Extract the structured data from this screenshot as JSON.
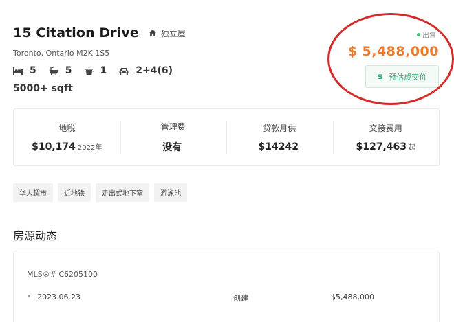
{
  "listing": {
    "address_title": "15 Citation Drive",
    "property_type": "独立屋",
    "location": "Toronto, Ontario M2K 1S5",
    "beds": "5",
    "baths": "5",
    "kitchens": "1",
    "parking": "2+4(6)",
    "sqft": "5000+ sqft",
    "status": "出售",
    "price": "$ 5,488,000",
    "estimate_dollar": "$",
    "estimate_label": "预估成交价"
  },
  "stats": [
    {
      "label": "地税",
      "value": "$10,174",
      "sub": "2022年"
    },
    {
      "label": "管理费",
      "value": "没有",
      "sub": ""
    },
    {
      "label": "贷款月供",
      "value": "$14242",
      "sub": ""
    },
    {
      "label": "交接费用",
      "value": "$127,463",
      "sub": "起"
    }
  ],
  "tags": [
    "华人超市",
    "近地铁",
    "走出式地下室",
    "游泳池"
  ],
  "history": {
    "section_title": "房源动态",
    "mls": "MLS®# C6205100",
    "rows": [
      {
        "bullet": "•",
        "date": "2023.06.23",
        "event": "创建",
        "price": "$5,488,000"
      }
    ]
  },
  "colors": {
    "price": "#ee7a2c",
    "estimate_green": "#2da86a",
    "status_dot": "#3cc47c",
    "annotation_circle": "#d42a2a"
  }
}
